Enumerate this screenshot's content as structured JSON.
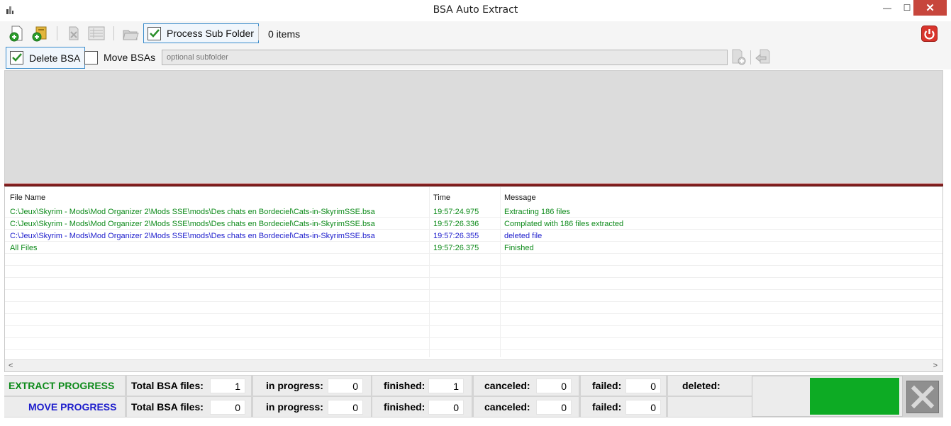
{
  "window": {
    "title": "BSA Auto Extract",
    "minimize": "—",
    "maximize": "☐",
    "close": "✕"
  },
  "toolbar": {
    "process_sub_folder_label": "Process Sub Folder",
    "items_label": "0 items",
    "delete_bsa_label": "Delete BSA",
    "move_bsas_label": "Move BSAs",
    "subfolder_placeholder": "optional subfolder",
    "process_sub_folder_checked": true,
    "delete_bsa_checked": true,
    "move_bsas_checked": false
  },
  "list": {
    "columns": {
      "file_name": "File Name",
      "time": "Time",
      "message": "Message"
    },
    "rows": [
      {
        "file": "C:\\Jeux\\Skyrim - Mods\\Mod Organizer 2\\Mods SSE\\mods\\Des chats en Bordeciel\\Cats-in-SkyrimSSE.bsa",
        "time": "19:57:24.975",
        "message": "Extracting 186 files",
        "color": "#0d8a1a"
      },
      {
        "file": "C:\\Jeux\\Skyrim - Mods\\Mod Organizer 2\\Mods SSE\\mods\\Des chats en Bordeciel\\Cats-in-SkyrimSSE.bsa",
        "time": "19:57:26.336",
        "message": "Complated with 186 files extracted",
        "color": "#0d8a1a"
      },
      {
        "file": "C:\\Jeux\\Skyrim - Mods\\Mod Organizer 2\\Mods SSE\\mods\\Des chats en Bordeciel\\Cats-in-SkyrimSSE.bsa",
        "time": "19:57:26.355",
        "message": "deleted file",
        "color": "#1d1dcc"
      },
      {
        "file": "All Files",
        "time": "19:57:26.375",
        "message": "Finished",
        "color": "#0d8a1a"
      }
    ],
    "scroll_left": "<",
    "scroll_right": ">"
  },
  "progress": {
    "extract": {
      "title": "EXTRACT PROGRESS",
      "total_label": "Total BSA files:",
      "total": "1",
      "in_progress_label": "in progress:",
      "in_progress": "0",
      "finished_label": "finished:",
      "finished": "1",
      "canceled_label": "canceled:",
      "canceled": "0",
      "failed_label": "failed:",
      "failed": "0",
      "deleted_label": "deleted:"
    },
    "move": {
      "title": "MOVE PROGRESS",
      "total_label": "Total BSA files:",
      "total": "0",
      "in_progress_label": "in progress:",
      "in_progress": "0",
      "finished_label": "finished:",
      "finished": "0",
      "canceled_label": "canceled:",
      "canceled": "0",
      "failed_label": "failed:",
      "failed": "0"
    },
    "status_color": "#0dab24"
  },
  "icons": [
    "app-icon",
    "add-file-icon",
    "add-folder-icon",
    "remove-icon",
    "list-icon",
    "open-folder-icon",
    "power-icon",
    "add-subfolder-icon",
    "move-arrow-icon",
    "cancel-x-icon"
  ]
}
